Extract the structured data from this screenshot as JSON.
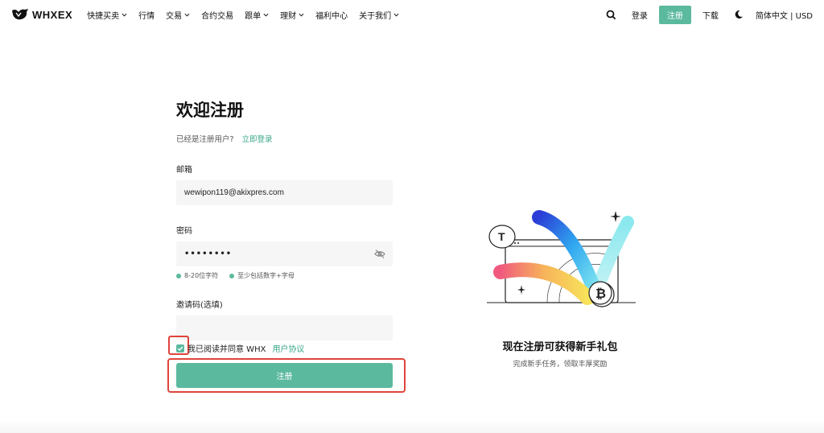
{
  "header": {
    "logo_text": "WHXEX",
    "nav": [
      {
        "label": "快捷买卖",
        "has_dropdown": true
      },
      {
        "label": "行情",
        "has_dropdown": false
      },
      {
        "label": "交易",
        "has_dropdown": true
      },
      {
        "label": "合约交易",
        "has_dropdown": false
      },
      {
        "label": "跟单",
        "has_dropdown": true
      },
      {
        "label": "理财",
        "has_dropdown": true
      },
      {
        "label": "福利中心",
        "has_dropdown": false
      },
      {
        "label": "关于我们",
        "has_dropdown": true
      }
    ],
    "search_icon": "search-icon",
    "login_label": "登录",
    "register_label": "注册",
    "download_label": "下载",
    "theme_icon": "moon-icon",
    "language_currency": "简体中文 | USD"
  },
  "form": {
    "title": "欢迎注册",
    "already_registered": "已经是注册用户?",
    "login_now": "立即登录",
    "email_label": "邮箱",
    "email_value": "wewipon119@akixpres.com",
    "password_label": "密码",
    "password_value": "••••••••",
    "password_hints": [
      "8-20位字符",
      "至少包括数字+字母"
    ],
    "invite_label": "邀请码(选填)",
    "invite_value": "",
    "agree_text": "我已阅读并同意 WHX",
    "agree_link": "用户协议",
    "agree_checked": true,
    "submit_label": "注册"
  },
  "promo": {
    "title": "现在注册可获得新手礼包",
    "subtitle": "完成新手任务，领取丰厚奖励"
  },
  "colors": {
    "accent": "#5bb99e",
    "highlight": "#e0443c"
  }
}
